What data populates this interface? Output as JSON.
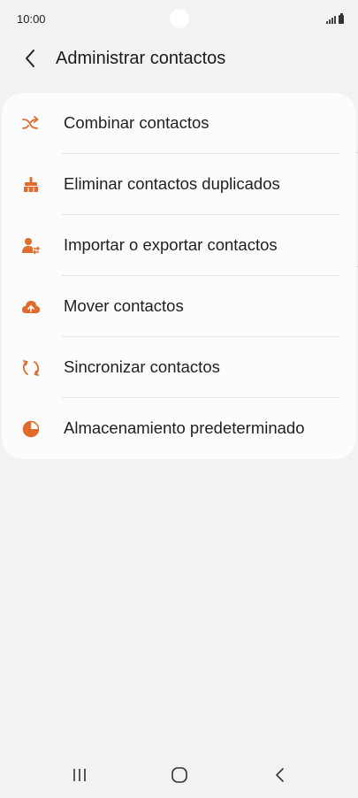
{
  "status_bar": {
    "time": "10:00"
  },
  "header": {
    "title": "Administrar contactos"
  },
  "menu": {
    "items": [
      {
        "label": "Combinar contactos",
        "icon": "merge-arrows-icon"
      },
      {
        "label": "Eliminar contactos duplicados",
        "icon": "broom-icon"
      },
      {
        "label": "Importar o exportar contactos",
        "icon": "person-transfer-icon"
      },
      {
        "label": "Mover contactos",
        "icon": "cloud-upload-icon"
      },
      {
        "label": "Sincronizar contactos",
        "icon": "sync-icon"
      },
      {
        "label": "Almacenamiento predeterminado",
        "icon": "pie-storage-icon"
      }
    ]
  },
  "colors": {
    "accent": "#e06b2c",
    "background": "#f2f2f2",
    "card": "#fcfcfc"
  },
  "nav_bar": {
    "buttons": [
      "recent-apps-icon",
      "home-icon",
      "back-icon"
    ]
  }
}
